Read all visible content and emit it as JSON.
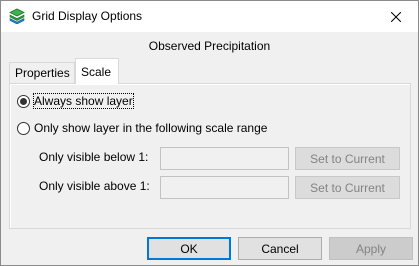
{
  "window": {
    "title": "Grid Display Options",
    "icon": "grid-layers-icon",
    "close_icon": "close-icon"
  },
  "subtitle": "Observed Precipitation",
  "tabs": [
    {
      "label": "Properties",
      "active": false
    },
    {
      "label": "Scale",
      "active": true
    }
  ],
  "scale": {
    "options": [
      {
        "label": "Always show layer",
        "selected": true
      },
      {
        "label": "Only show layer in the following scale range",
        "selected": false
      }
    ],
    "below_label": "Only visible below 1:",
    "below_value": "",
    "above_label": "Only visible above 1:",
    "above_value": "",
    "set_to_current_label": "Set to Current"
  },
  "buttons": {
    "ok": "OK",
    "cancel": "Cancel",
    "apply": "Apply"
  },
  "colors": {
    "accent": "#0078d7",
    "disabled_text": "#838383",
    "icon_green": "#2e9b3f"
  }
}
